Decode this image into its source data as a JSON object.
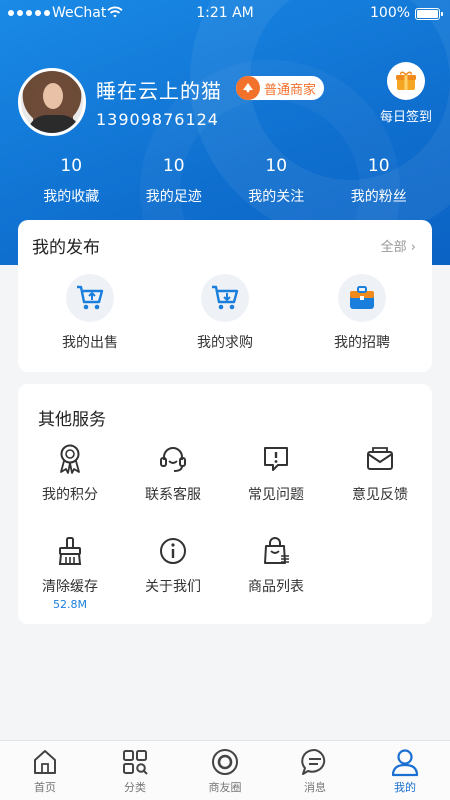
{
  "status_bar": {
    "carrier": "WeChat",
    "time": "1:21 AM",
    "battery": "100%"
  },
  "profile": {
    "username": "睡在云上的猫",
    "badge": "普通商家",
    "phone": "13909876124",
    "checkin_label": "每日签到"
  },
  "stats": [
    {
      "value": "10",
      "label": "我的收藏"
    },
    {
      "value": "10",
      "label": "我的足迹"
    },
    {
      "value": "10",
      "label": "我的关注"
    },
    {
      "value": "10",
      "label": "我的粉丝"
    }
  ],
  "publish": {
    "title": "我的发布",
    "more": "全部 ›",
    "items": [
      {
        "label": "我的出售",
        "icon": "cart-upload-icon"
      },
      {
        "label": "我的求购",
        "icon": "cart-download-icon"
      },
      {
        "label": "我的招聘",
        "icon": "briefcase-icon"
      }
    ]
  },
  "services": {
    "title": "其他服务",
    "items": [
      {
        "label": "我的积分",
        "icon": "award-icon"
      },
      {
        "label": "联系客服",
        "icon": "headset-icon"
      },
      {
        "label": "常见问题",
        "icon": "faq-icon"
      },
      {
        "label": "意见反馈",
        "icon": "feedback-mail-icon"
      },
      {
        "label": "清除缓存",
        "icon": "broom-icon",
        "sub": "52.8M"
      },
      {
        "label": "关于我们",
        "icon": "info-icon"
      },
      {
        "label": "商品列表",
        "icon": "shopping-bag-icon"
      }
    ]
  },
  "tabbar": [
    {
      "label": "首页",
      "icon": "home-icon"
    },
    {
      "label": "分类",
      "icon": "category-icon"
    },
    {
      "label": "商友圈",
      "icon": "circle-icon"
    },
    {
      "label": "消息",
      "icon": "message-icon"
    },
    {
      "label": "我的",
      "icon": "user-icon",
      "active": true
    }
  ],
  "colors": {
    "primary": "#1a7fdc",
    "badge": "#f2712b",
    "card_bg": "#ffffff",
    "page_bg": "#f4f5f7"
  }
}
